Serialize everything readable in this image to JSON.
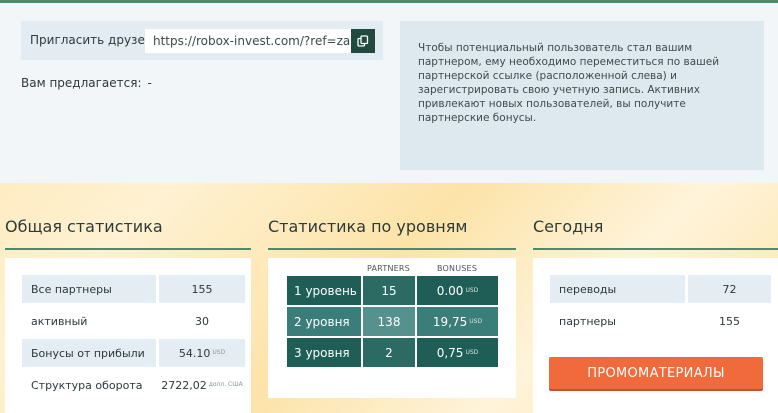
{
  "invite": {
    "label": "Пригласить друзей:",
    "url": "https://robox-invest.com/?ref=zanozaa",
    "copy_icon": "copy-icon"
  },
  "offered": {
    "label": "Вам предлагается:",
    "value": "-"
  },
  "info_text": "Чтобы потенциальный пользователь стал вашим партнером, ему необходимо переместиться по вашей партнерской ссылке (расположенной слева) и зарегистрировать свою учетную запись. Активних привлекают новых пользователей, вы получите партнерские бонусы.",
  "general": {
    "title": "Общая статистика",
    "rows": [
      {
        "label": "Все партнеры",
        "value": "155",
        "unit": ""
      },
      {
        "label": "активный",
        "value": "30",
        "unit": ""
      },
      {
        "label": "Бонусы от прибыли",
        "value": "54.10",
        "unit": "USD"
      },
      {
        "label": "Структура оборота",
        "value": "2722,02",
        "unit": "долл. США"
      }
    ]
  },
  "levels": {
    "title": "Статистика по уровням",
    "col_partners": "PARTNERS",
    "col_bonuses": "BONUSES",
    "rows": [
      {
        "name": "1 уровень",
        "partners": "15",
        "bonus": "0.00",
        "unit": "USD"
      },
      {
        "name": "2 уровня",
        "partners": "138",
        "bonus": "19,75",
        "unit": "USD"
      },
      {
        "name": "3 уровня",
        "partners": "2",
        "bonus": "0,75",
        "unit": "USD"
      }
    ]
  },
  "today": {
    "title": "Сегодня",
    "rows": [
      {
        "label": "переводы",
        "value": "72"
      },
      {
        "label": "партнеры",
        "value": "155"
      }
    ],
    "promo_button": "ПРОМОМАТЕРИАЛЫ"
  },
  "colors": {
    "accent_green": "#4d8a6a",
    "dark_teal": "#1f5e57",
    "promo_orange": "#f16a3c"
  }
}
